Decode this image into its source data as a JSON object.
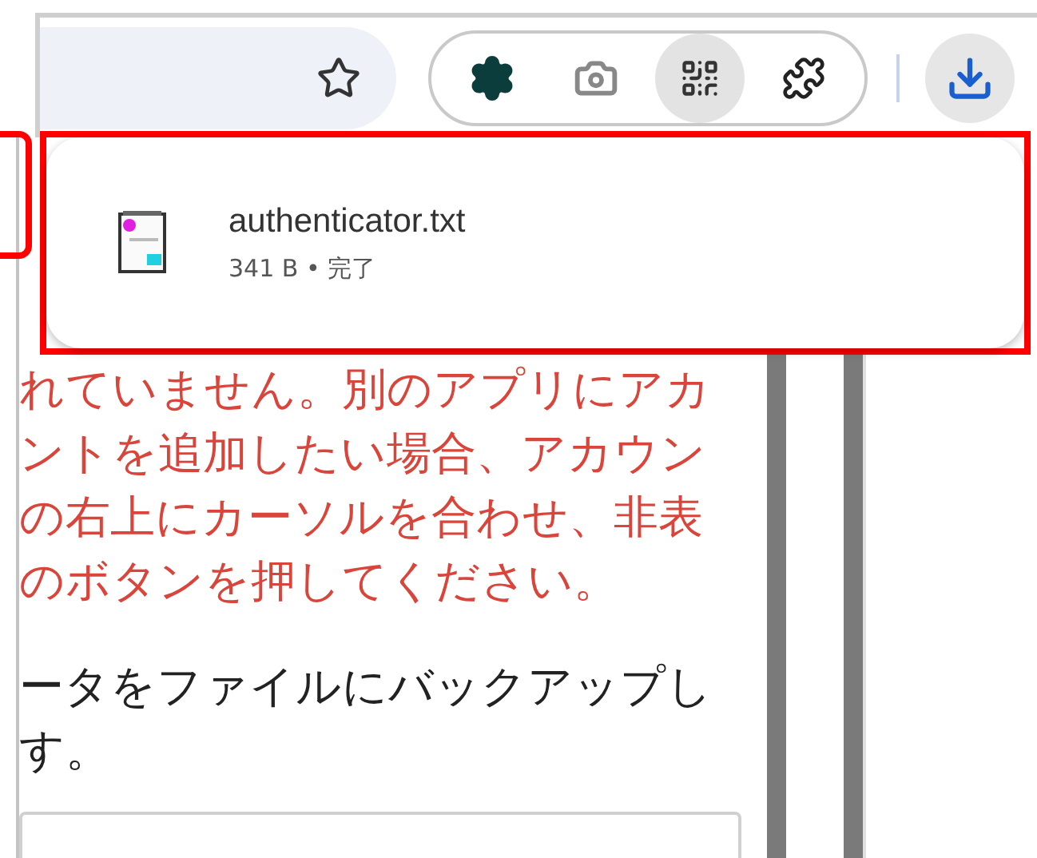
{
  "download_popup": {
    "file_name": "authenticator.txt",
    "status": "341 B • 完了"
  },
  "content": {
    "warning_lines": [
      "れていません。別のアプリにアカ",
      "ントを追加したい場合、アカウン",
      "の右上にカーソルを合わせ、非表",
      "のボタンを押してください。"
    ],
    "body_lines": [
      "ータをファイルにバックアップし",
      "す。"
    ]
  }
}
